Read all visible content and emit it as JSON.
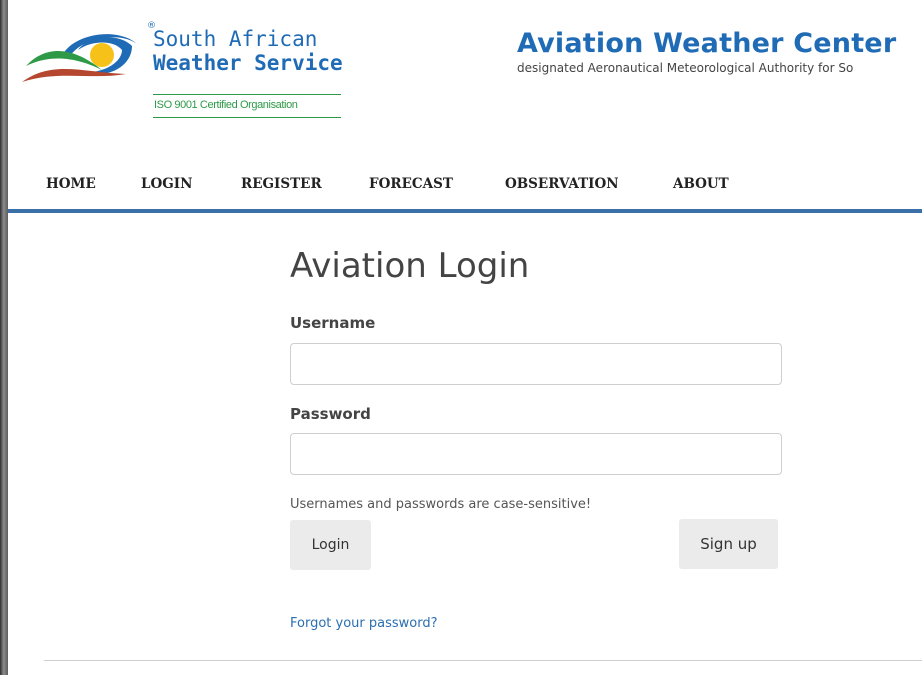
{
  "logo": {
    "line1": "South African",
    "line2": "Weather Service",
    "registered": "®",
    "iso": "ISO 9001 Certified Organisation"
  },
  "header": {
    "title": "Aviation Weather Center",
    "subtitle": "designated Aeronautical Meteorological Authority for So"
  },
  "nav": {
    "items": [
      {
        "label": "HOME"
      },
      {
        "label": "LOGIN"
      },
      {
        "label": "REGISTER"
      },
      {
        "label": "FORECAST"
      },
      {
        "label": "OBSERVATION"
      },
      {
        "label": "ABOUT"
      }
    ]
  },
  "login": {
    "title": "Aviation Login",
    "username_label": "Username",
    "username_value": "",
    "password_label": "Password",
    "password_value": "",
    "hint": "Usernames and passwords are case-sensitive!",
    "login_button": "Login",
    "signup_button": "Sign up",
    "forgot_link": "Forgot your password?"
  },
  "colors": {
    "brand_blue": "#1f6bb5",
    "nav_rule": "#3b6fa8",
    "iso_green": "#2e9a47",
    "link": "#2a6fb0"
  }
}
